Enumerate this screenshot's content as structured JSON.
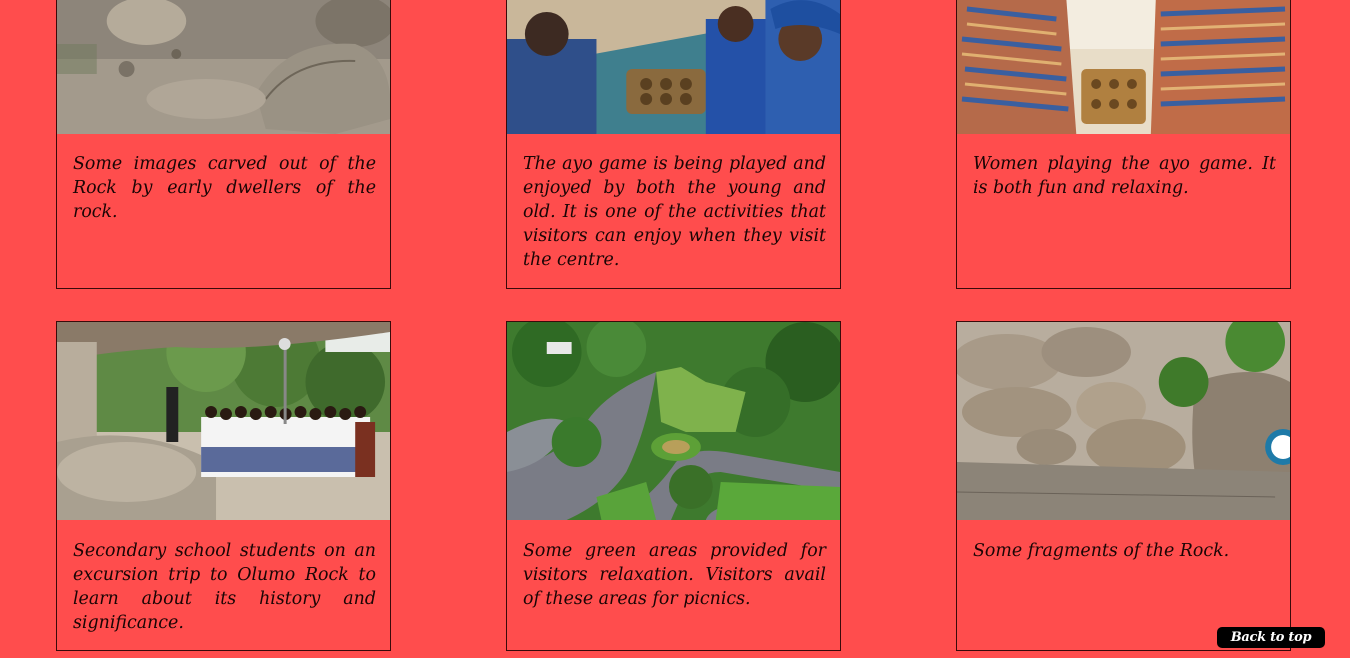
{
  "gallery": {
    "cards": [
      {
        "image_alt": "carved-stone-images",
        "caption": "Some images carved out of the Rock by early dwellers of the rock."
      },
      {
        "image_alt": "ayo-game-players",
        "caption": "The ayo game is being played and enjoyed by both the young and old. It is one of the activities that visitors can enjoy when they visit the centre."
      },
      {
        "image_alt": "women-playing-ayo",
        "caption": "Women playing the ayo game. It is both fun and relaxing."
      },
      {
        "image_alt": "school-excursion",
        "caption": "Secondary school students on an excursion trip to Olumo Rock to learn about its history and significance."
      },
      {
        "image_alt": "green-areas-aerial",
        "caption": "Some green areas provided for visitors relaxation. Visitors avail of these areas for picnics."
      },
      {
        "image_alt": "rock-fragments",
        "caption": "Some fragments of the Rock."
      }
    ]
  },
  "back_to_top": {
    "label": "Back to top"
  },
  "colors": {
    "background": "#ff4d4d",
    "button": "#000000",
    "button_text": "#ffffff"
  }
}
